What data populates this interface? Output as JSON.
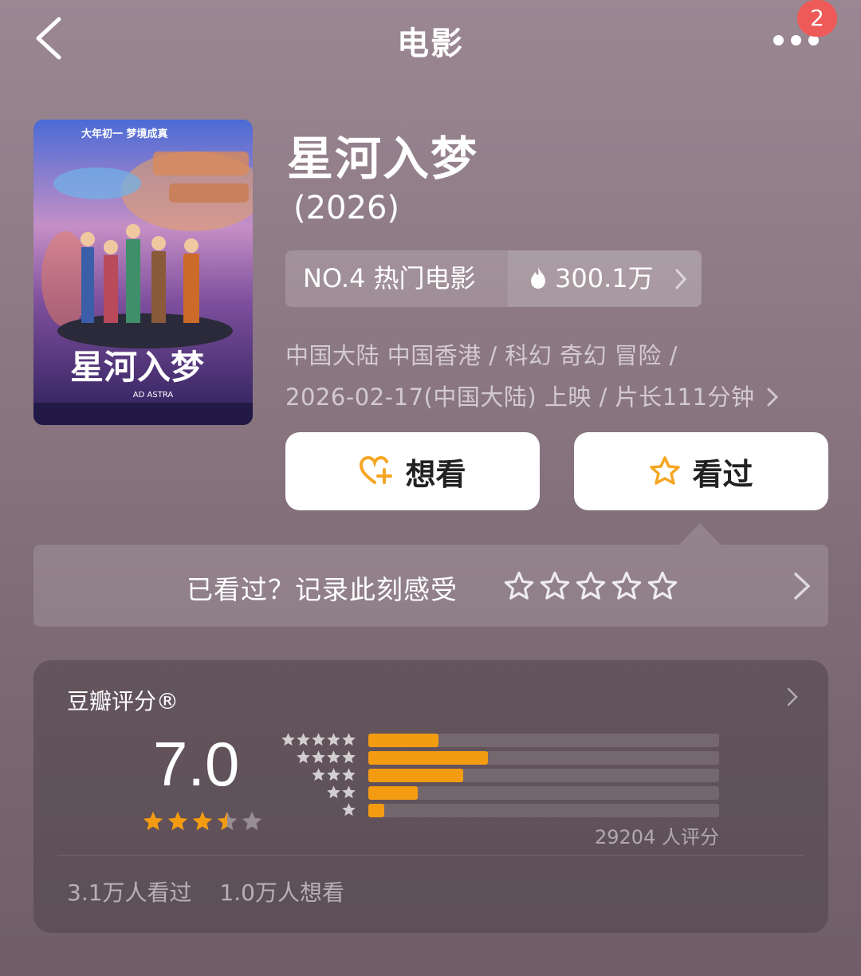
{
  "nav": {
    "title": "电影",
    "badge": "2"
  },
  "movie": {
    "title": "星河入梦",
    "year": "(2026)",
    "rank_label": "NO.4 热门电影",
    "heat": "300.1万",
    "meta_line1": "中国大陆 中国香港 / 科幻 奇幻 冒险 /",
    "meta_line2": "2026-02-17(中国大陆) 上映 / 片长111分钟",
    "poster_slogan": "大年初一 梦境成真",
    "poster_title": "星河入梦",
    "poster_en": "AD ASTRA"
  },
  "actions": {
    "want_label": "想看",
    "seen_label": "看过"
  },
  "record": {
    "text": "已看过？记录此刻感受"
  },
  "rating": {
    "label": "豆瓣评分®",
    "score": "7.0",
    "stars": 3.5,
    "distribution": [
      {
        "stars": 5,
        "fraction": 0.2
      },
      {
        "stars": 4,
        "fraction": 0.34
      },
      {
        "stars": 3,
        "fraction": 0.27
      },
      {
        "stars": 2,
        "fraction": 0.14
      },
      {
        "stars": 1,
        "fraction": 0.045
      }
    ],
    "count_text": "29204 人评分",
    "seen_text": "3.1万人看过",
    "want_text": "1.0万人想看"
  },
  "colors": {
    "accent": "#f39c12",
    "badge": "#ee5a57",
    "heart": "#f5a623"
  }
}
